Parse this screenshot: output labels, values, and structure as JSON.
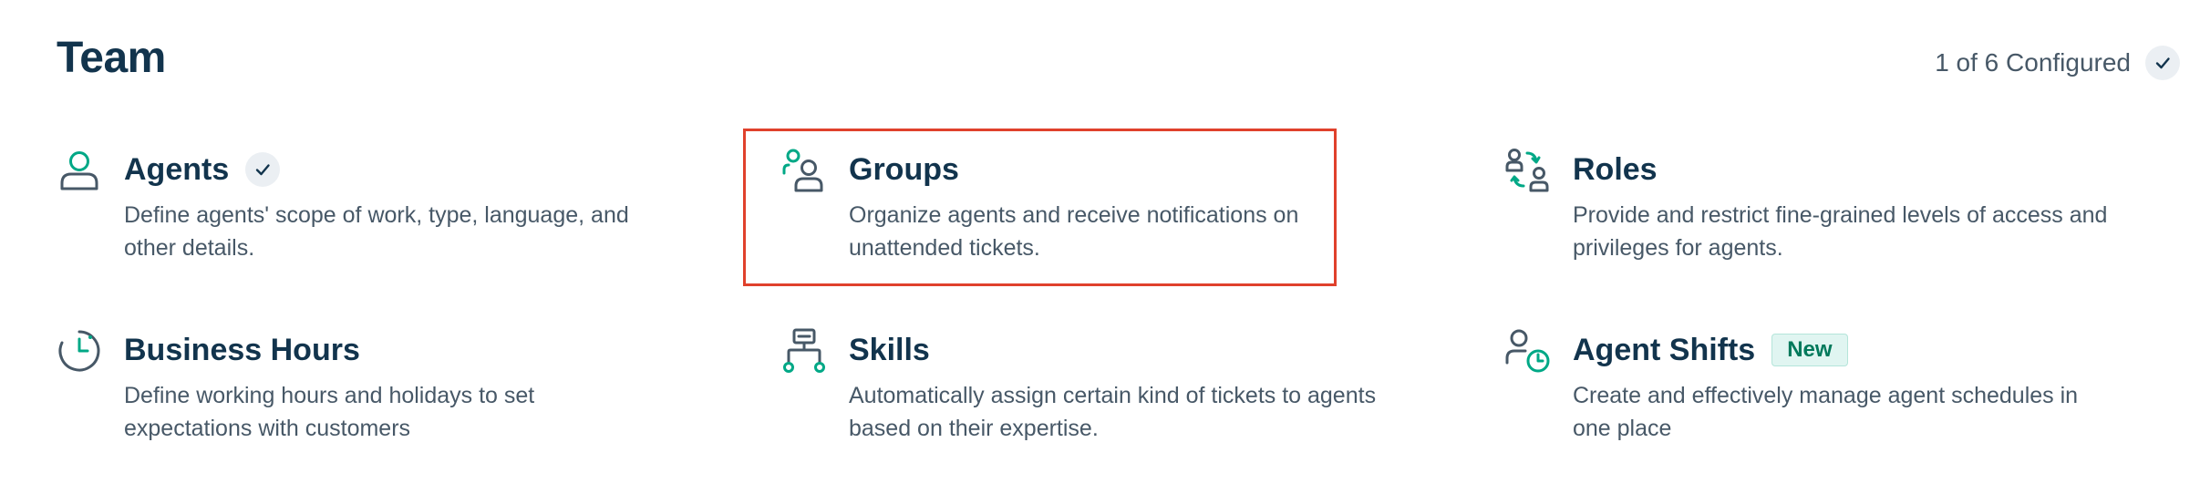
{
  "header": {
    "title": "Team",
    "config_status": "1 of 6 Configured"
  },
  "colors": {
    "accent": "#00a886",
    "text_primary": "#12344d",
    "text_secondary": "#475867",
    "highlight_border": "#e0412c",
    "badge_bg": "#e0f5f1",
    "badge_text": "#00795b"
  },
  "cards": {
    "agents": {
      "title": "Agents",
      "description": "Define agents' scope of work, type, language, and other details.",
      "icon": "person-icon",
      "configured": true
    },
    "groups": {
      "title": "Groups",
      "description": "Organize agents and receive notifications on unattended tickets.",
      "icon": "group-icon",
      "highlighted": true
    },
    "roles": {
      "title": "Roles",
      "description": "Provide and restrict fine-grained levels of access and privileges for agents.",
      "icon": "roles-icon"
    },
    "business_hours": {
      "title": "Business Hours",
      "description": "Define working hours and holidays to set expectations with customers",
      "icon": "clock-icon"
    },
    "skills": {
      "title": "Skills",
      "description": "Automatically assign certain kind of tickets to agents based on their expertise.",
      "icon": "skills-tree-icon"
    },
    "agent_shifts": {
      "title": "Agent Shifts",
      "badge": "New",
      "description": "Create and effectively manage agent schedules in one place",
      "icon": "agent-shift-icon"
    }
  }
}
